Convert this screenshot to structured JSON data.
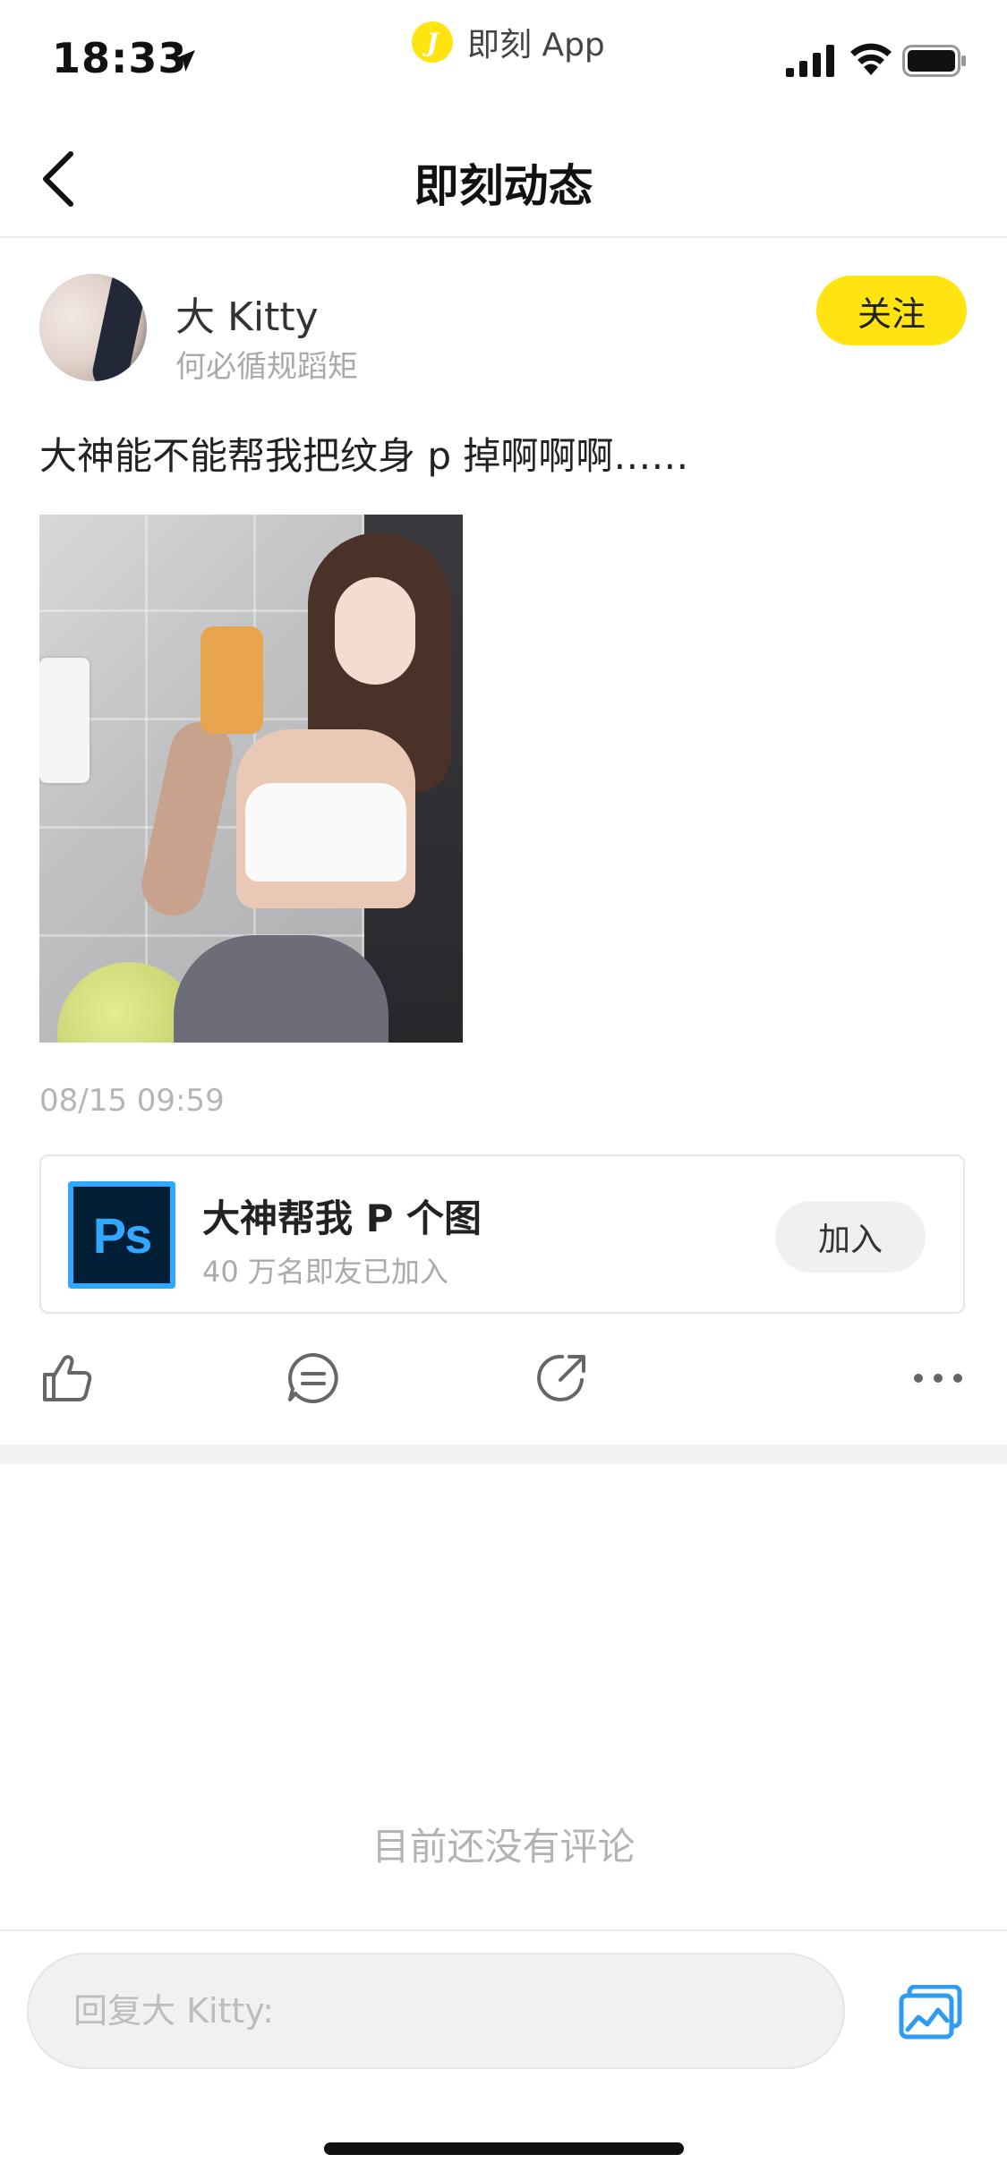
{
  "status_bar": {
    "time": "18:33",
    "app_name": "即刻 App",
    "app_logo_letter": "J"
  },
  "nav": {
    "title": "即刻动态"
  },
  "post": {
    "author_name": "大 Kitty",
    "author_bio": "何必循规蹈矩",
    "follow_label": "关注",
    "text": "大神能不能帮我把纹身 p 掉啊啊啊……",
    "timestamp": "08/15 09:59"
  },
  "topic": {
    "logo_text": "Ps",
    "title": "大神帮我 P 个图",
    "meta": "40 万名即友已加入",
    "join_label": "加入"
  },
  "actions": {
    "icons": [
      "thumbs-up-icon",
      "comment-icon",
      "share-icon",
      "more-icon"
    ]
  },
  "comments": {
    "empty_text": "目前还没有评论"
  },
  "reply": {
    "placeholder": "回复大 Kitty:"
  },
  "colors": {
    "accent_yellow": "#FFE411",
    "photoshop_blue": "#31A8FF",
    "photoshop_dark": "#001E36",
    "image_icon_blue": "#2E9BF0"
  }
}
